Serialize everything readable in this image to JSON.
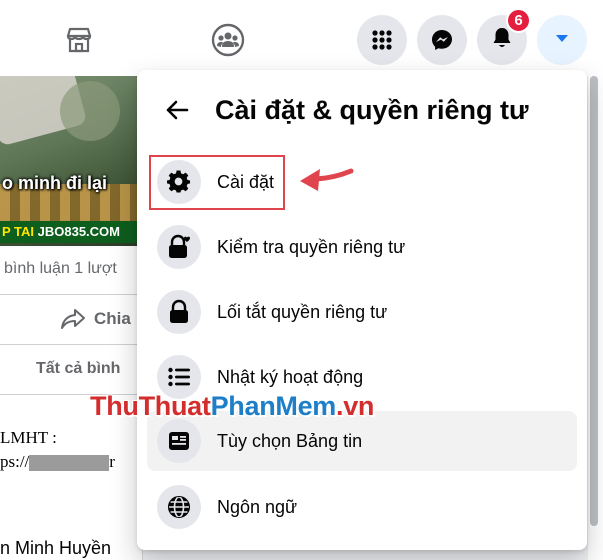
{
  "header": {
    "marketplace_icon": "storefront-icon",
    "groups_icon": "groups-icon",
    "menu_icon": "grid-menu-icon",
    "messenger_icon": "messenger-icon",
    "notifications_icon": "bell-icon",
    "notifications_count": "6",
    "account_icon": "caret-down-icon"
  },
  "post": {
    "caption": "o minh đi lại",
    "ad_prefix": "P TAI ",
    "ad_text": "JBO835.COM",
    "stats": "bình luận  1 lượt",
    "share_label": "Chia",
    "all_comments": "Tất cả bình",
    "comment_line1": "LMHT :",
    "comment_line2": "ps://",
    "comment_line2_end": "r",
    "comment_author": "n Minh Huyền"
  },
  "panel": {
    "title": "Cài đặt & quyền riêng tư",
    "items": [
      {
        "label": "Cài đặt",
        "icon": "gear-icon"
      },
      {
        "label": "Kiểm tra quyền riêng tư",
        "icon": "lock-heart-icon"
      },
      {
        "label": "Lối tắt quyền riêng tư",
        "icon": "lock-icon"
      },
      {
        "label": "Nhật ký hoạt động",
        "icon": "list-icon"
      },
      {
        "label": "Tùy chọn Bảng tin",
        "icon": "news-feed-icon"
      },
      {
        "label": "Ngôn ngữ",
        "icon": "globe-icon"
      }
    ]
  },
  "watermark": {
    "part1": "ThuThuat",
    "part2": "PhanMem",
    "part3": ".vn"
  },
  "colors": {
    "accent_blue": "#1877f2",
    "badge_red": "#e41e3f",
    "annotation_red": "#e0454e"
  }
}
